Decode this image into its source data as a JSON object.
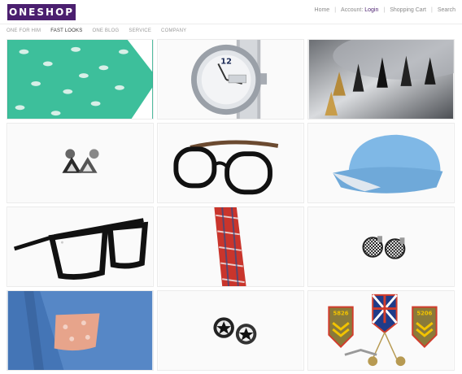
{
  "brand": {
    "logo": "ONESHOP",
    "color": "#4b1f6f"
  },
  "topnav": {
    "home": "Home",
    "account": "Account:",
    "login": "Login",
    "cart": "Shopping Cart",
    "search": "Search"
  },
  "subnav": [
    {
      "label": "ONE FOR HIM",
      "active": false
    },
    {
      "label": "FAST LOOKS",
      "active": true
    },
    {
      "label": "ONE BLOG",
      "active": false
    },
    {
      "label": "SERVICE",
      "active": false
    },
    {
      "label": "COMPANY",
      "active": false
    }
  ],
  "products": [
    {
      "name": "teal-bird-print-tie",
      "icon": "tie-icon"
    },
    {
      "name": "silver-wristwatch",
      "icon": "watch-icon"
    },
    {
      "name": "spike-studs",
      "icon": "spike-icon"
    },
    {
      "name": "triangle-stud-earrings",
      "icon": "earring-icon"
    },
    {
      "name": "black-round-glasses",
      "icon": "glasses-icon"
    },
    {
      "name": "blue-cap",
      "icon": "cap-icon"
    },
    {
      "name": "black-wayfarer-glasses",
      "icon": "glasses-icon"
    },
    {
      "name": "plaid-tie",
      "icon": "tie-icon"
    },
    {
      "name": "checkered-stud-earrings",
      "icon": "earring-icon"
    },
    {
      "name": "blue-blazer-pocket-square",
      "icon": "blazer-icon"
    },
    {
      "name": "star-stud-earrings",
      "icon": "earring-icon"
    },
    {
      "name": "military-badges",
      "icon": "badge-icon"
    }
  ],
  "badges": {
    "left": "5826",
    "right": "5206"
  }
}
